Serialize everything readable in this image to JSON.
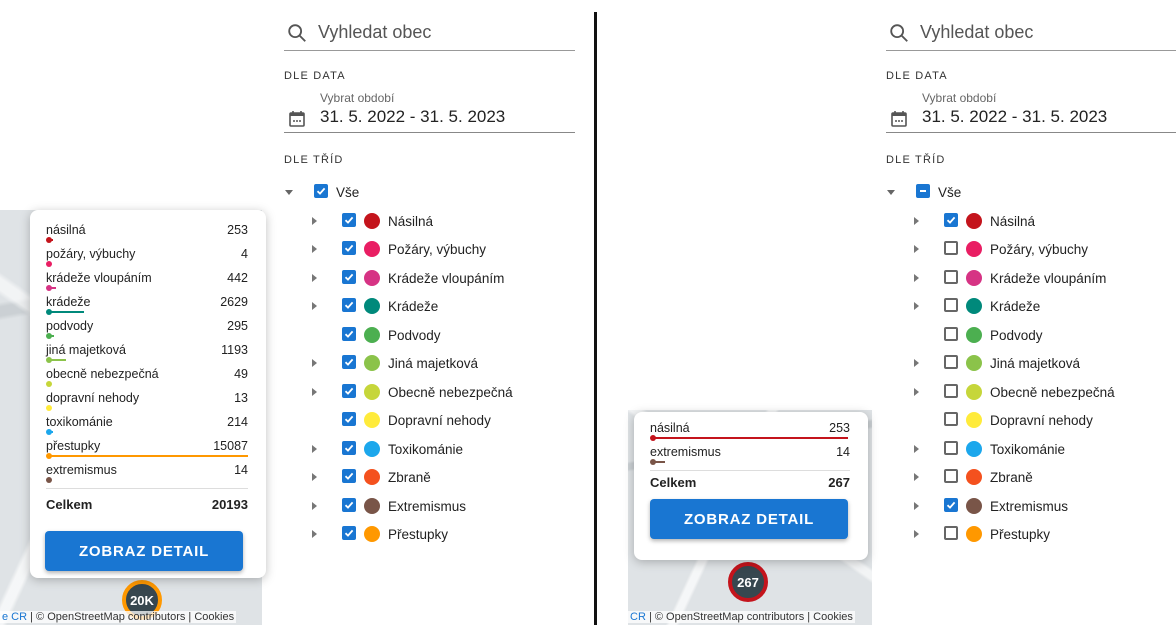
{
  "filter": {
    "search_placeholder": "Vyhledat obec",
    "date_section": "DLE DATA",
    "date_label": "Vybrat období",
    "date_value": "31. 5. 2022 - 31. 5. 2023",
    "class_section": "DLE TŘÍD",
    "all_label": "Vše"
  },
  "categories": [
    {
      "label": "Násilná",
      "color": "#c4141c",
      "expandable": true
    },
    {
      "label": "Požáry, výbuchy",
      "color": "#e91e63",
      "expandable": true
    },
    {
      "label": "Krádeže vloupáním",
      "color": "#d63384",
      "expandable": true
    },
    {
      "label": "Krádeže",
      "color": "#00897b",
      "expandable": true
    },
    {
      "label": "Podvody",
      "color": "#4caf50",
      "expandable": false
    },
    {
      "label": "Jiná majetková",
      "color": "#8bc34a",
      "expandable": true
    },
    {
      "label": "Obecně nebezpečná",
      "color": "#c6d63a",
      "expandable": true
    },
    {
      "label": "Dopravní nehody",
      "color": "#ffeb3b",
      "expandable": false
    },
    {
      "label": "Toxikománie",
      "color": "#1ca7ec",
      "expandable": true
    },
    {
      "label": "Zbraně",
      "color": "#f4511e",
      "expandable": true
    },
    {
      "label": "Extremismus",
      "color": "#795548",
      "expandable": true
    },
    {
      "label": "Přestupky",
      "color": "#ff9800",
      "expandable": true
    }
  ],
  "left": {
    "popup": {
      "rows": [
        {
          "label": "násilná",
          "count": "253",
          "color": "#c4141c",
          "share": 0.017
        },
        {
          "label": "požáry, výbuchy",
          "count": "4",
          "color": "#e91e63",
          "share": 0.0003
        },
        {
          "label": "krádeže vloupáním",
          "count": "442",
          "color": "#d63384",
          "share": 0.029
        },
        {
          "label": "krádeže",
          "count": "2629",
          "color": "#00897b",
          "share": 0.174
        },
        {
          "label": "podvody",
          "count": "295",
          "color": "#4caf50",
          "share": 0.02
        },
        {
          "label": "jiná majetková",
          "count": "1193",
          "color": "#8bc34a",
          "share": 0.079
        },
        {
          "label": "obecně nebezpečná",
          "count": "49",
          "color": "#c6d63a",
          "share": 0.003
        },
        {
          "label": "dopravní nehody",
          "count": "13",
          "color": "#ffeb3b",
          "share": 0.001
        },
        {
          "label": "toxikománie",
          "count": "214",
          "color": "#1ca7ec",
          "share": 0.014
        },
        {
          "label": "přestupky",
          "count": "15087",
          "color": "#ff9800",
          "share": 1.0
        },
        {
          "label": "extremismus",
          "count": "14",
          "color": "#795548",
          "share": 0.001
        }
      ],
      "total_label": "Celkem",
      "total_value": "20193",
      "button": "ZOBRAZ DETAIL"
    },
    "cluster_label": "20K",
    "attribution_prefix": "e CR",
    "attribution_text": " | © OpenStreetMap contributors | Cookies",
    "checks": [
      true,
      true,
      true,
      true,
      true,
      true,
      true,
      true,
      true,
      true,
      true,
      true
    ],
    "all_state": "checked"
  },
  "right": {
    "popup": {
      "rows": [
        {
          "label": "násilná",
          "count": "253",
          "color": "#c4141c",
          "share": 1.0
        },
        {
          "label": "extremismus",
          "count": "14",
          "color": "#795548",
          "share": 0.055
        }
      ],
      "total_label": "Celkem",
      "total_value": "267",
      "button": "ZOBRAZ DETAIL"
    },
    "cluster_label": "267",
    "attribution_prefix": "CR",
    "attribution_text": " | © OpenStreetMap contributors | Cookies",
    "checks": [
      true,
      false,
      false,
      false,
      false,
      false,
      false,
      false,
      false,
      false,
      true,
      false
    ],
    "all_state": "indeterminate"
  }
}
